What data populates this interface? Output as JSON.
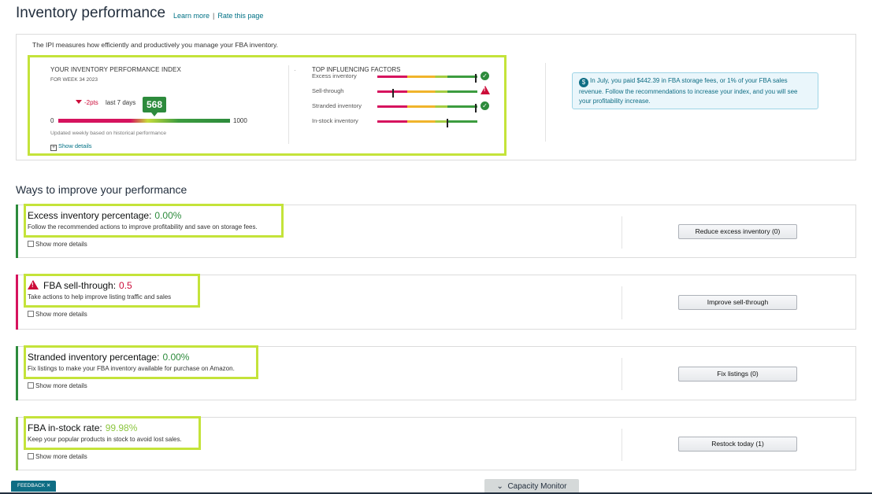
{
  "header": {
    "title": "Inventory performance",
    "learn_more": "Learn more",
    "separator": "|",
    "rate_page": "Rate this page"
  },
  "ipi": {
    "description": "The IPI measures how efficiently and productively you manage your FBA inventory.",
    "heading": "YOUR INVENTORY PERFORMANCE INDEX",
    "week": "FOR WEEK 34 2023",
    "delta": "-2pts",
    "delta_period": "last 7 days",
    "score": "568",
    "score_value": 568,
    "scale_min": "0",
    "scale_max": "1000",
    "updated_note": "Updated weekly based on historical performance",
    "show_details": "Show details"
  },
  "factors": {
    "heading": "TOP INFLUENCING FACTORS",
    "items": [
      {
        "label": "Excess inventory",
        "position": 0.99,
        "status": "ok"
      },
      {
        "label": "Sell-through",
        "position": 0.15,
        "status": "warning"
      },
      {
        "label": "Stranded inventory",
        "position": 0.99,
        "status": "ok"
      },
      {
        "label": "In-stock inventory",
        "position": 0.7,
        "status": "none"
      }
    ]
  },
  "info": {
    "icon": "dollar-icon",
    "text": "In July, you paid $442.39 in FBA storage fees, or 1% of your FBA sales revenue. Follow the recommendations to increase your index, and you will see your profitability increase."
  },
  "improve": {
    "title": "Ways to improve your performance",
    "show_more": "Show more details",
    "metrics": [
      {
        "name": "Excess inventory percentage:",
        "value": "0.00%",
        "value_color": "#2d8b3c",
        "accent": "#2d8b3c",
        "desc": "Follow the recommended actions to improve profitability and save on storage fees.",
        "button": "Reduce excess inventory (0)",
        "warning": false
      },
      {
        "name": "FBA sell-through:",
        "value": "0.5",
        "value_color": "#cc0c39",
        "accent": "#d6135e",
        "desc": "Take actions to help improve listing traffic and sales",
        "button": "Improve sell-through",
        "warning": true
      },
      {
        "name": "Stranded inventory percentage:",
        "value": "0.00%",
        "value_color": "#2d8b3c",
        "accent": "#2d8b3c",
        "desc": "Fix listings to make your FBA inventory available for purchase on Amazon.",
        "button": "Fix listings (0)",
        "warning": false
      },
      {
        "name": "FBA in-stock rate:",
        "value": "99.98%",
        "value_color": "#8cc63f",
        "accent": "#8cc63f",
        "desc": "Keep your popular products in stock to avoid lost sales.",
        "button": "Restock today (1)",
        "warning": false
      }
    ]
  },
  "footer": {
    "feedback": "FEEDBACK ✕",
    "capacity": "Capacity Monitor"
  }
}
